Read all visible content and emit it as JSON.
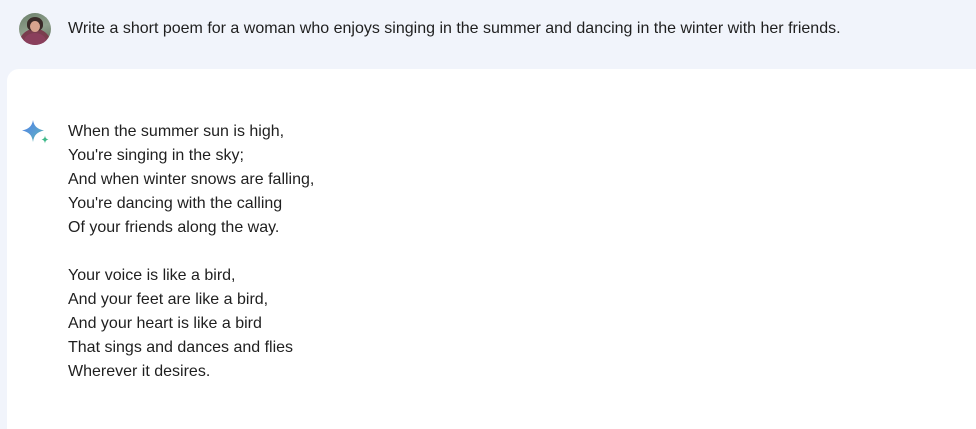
{
  "prompt": {
    "avatar_icon": "user-avatar",
    "text": "Write a short poem for a woman who enjoys singing in the summer and dancing in the winter with her friends."
  },
  "response": {
    "icon": "gemini-sparkle-icon",
    "stanzas": [
      {
        "lines": [
          "When the summer sun is high,",
          "You're singing in the sky;",
          "And when winter snows are falling,",
          "You're dancing with the calling",
          "Of your friends along the way."
        ]
      },
      {
        "lines": [
          "Your voice is like a bird,",
          "And your feet are like a bird,",
          "And your heart is like a bird",
          "That sings and dances and flies",
          "Wherever it desires."
        ]
      }
    ]
  },
  "colors": {
    "page_background": "#f1f4fb",
    "card_background": "#ffffff",
    "text": "#1f1f1f",
    "sparkle_blue": "#4f7fe8",
    "sparkle_green": "#3fb98a"
  }
}
